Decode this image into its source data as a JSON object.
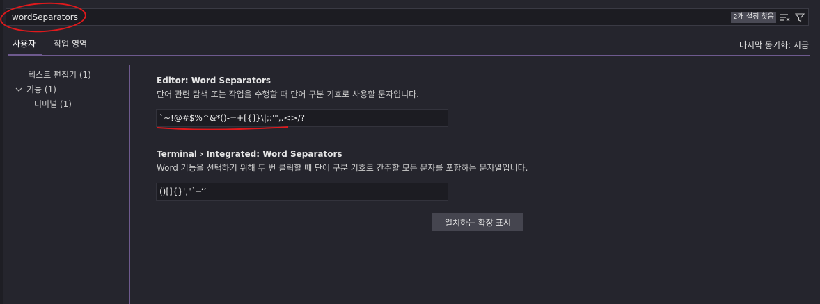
{
  "search": {
    "value": "wordSeparators",
    "result_count": "2개 설정 찾음"
  },
  "icons": {
    "clear_filter": "clear-filter-icon",
    "filter": "filter-icon",
    "chevron": "chevron-down-icon"
  },
  "tabs": [
    {
      "label": "사용자"
    },
    {
      "label": "작업 영역"
    }
  ],
  "sync_status": "마지막 동기화: 지금",
  "toc": [
    {
      "label": "텍스트 편집기 (1)"
    },
    {
      "label": "기능 (1)"
    },
    {
      "label": "터미널 (1)"
    }
  ],
  "settings": [
    {
      "title": "Editor: Word Separators",
      "description": "단어 관련 탐색 또는 작업을 수행할 때 단어 구분 기호로 사용할 문자입니다.",
      "value": "`~!@#$%^&*()-=+[{]}\\|;:'\",.<>/?"
    },
    {
      "title": "Terminal › Integrated: Word Separators",
      "description": "Word 기능을 선택하기 위해 두 번 클릭할 때 단어 구분 기호로 간주할 모든 문자를 포함하는 문자열입니다.",
      "value": "()[]{}',\"`─‘’"
    }
  ],
  "extension_button": "일치하는 확장 표시",
  "colors": {
    "background": "#25252d",
    "accent_divider": "#6e5a8e",
    "annotation_red": "#e0191c"
  }
}
